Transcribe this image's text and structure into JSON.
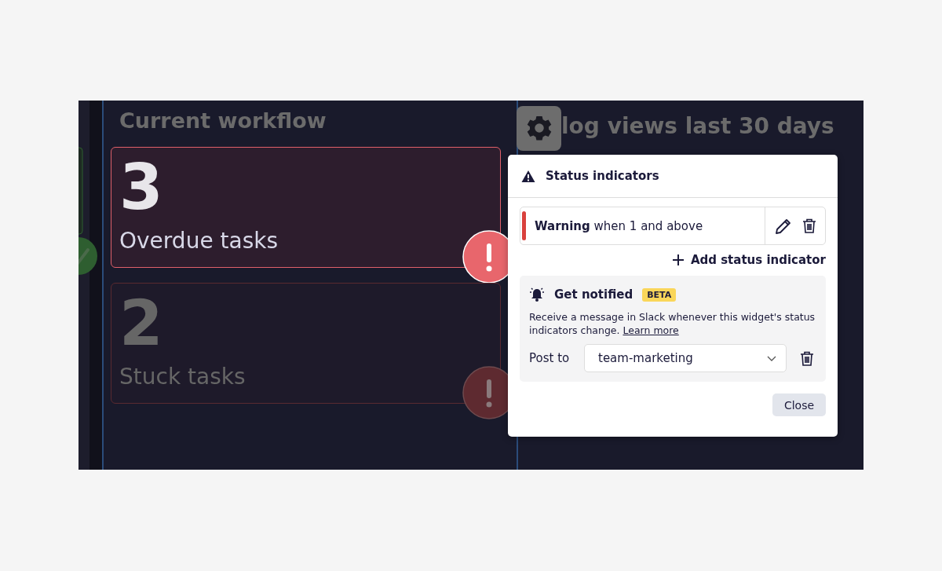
{
  "workflow": {
    "title": "Current workflow",
    "metrics": [
      {
        "value": "3",
        "label": "Overdue tasks",
        "highlighted": true
      },
      {
        "value": "2",
        "label": "Stuck tasks",
        "highlighted": false
      }
    ]
  },
  "views_widget": {
    "title": "log views last 30 days"
  },
  "popup": {
    "title": "Status indicators",
    "indicators": [
      {
        "severity": "Warning",
        "rule": "when 1 and above",
        "color": "#d9413d"
      }
    ],
    "add_label": "Add status indicator",
    "notify": {
      "title": "Get notified",
      "badge": "BETA",
      "description": "Receive a message in Slack whenever this widget's status indicators change.",
      "link": "Learn more",
      "post_label": "Post to",
      "channel": "team-marketing"
    },
    "close": "Close"
  }
}
